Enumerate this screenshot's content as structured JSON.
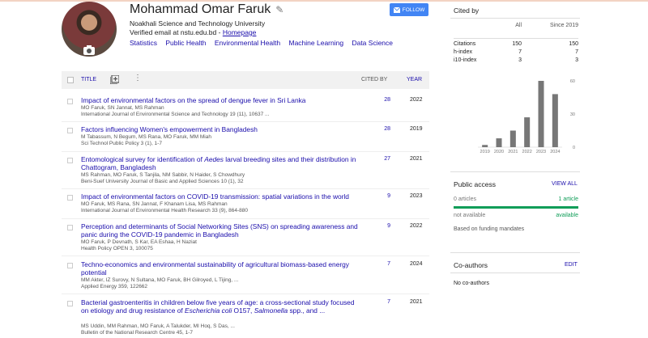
{
  "profile": {
    "name": "Mohammad Omar Faruk",
    "affiliation": "Noakhali Science and Technology University",
    "email_text": "Verified email at nstu.edu.bd - ",
    "homepage_label": "Homepage",
    "interests": [
      "Statistics",
      "Public Health",
      "Environmental Health",
      "Machine Learning",
      "Data Science"
    ],
    "follow_label": "FOLLOW"
  },
  "table": {
    "title_header": "TITLE",
    "cited_by_header": "CITED BY",
    "year_header": "YEAR",
    "rows": [
      {
        "title": "Impact of environmental factors on the spread of dengue fever in Sri Lanka",
        "authors": "MO Faruk, SN Jannat, MS Rahman",
        "venue": "International Journal of Environmental Science and Technology 19 (11), 10637 ...",
        "cited_by": "28",
        "year": "2022"
      },
      {
        "title": "Factors influencing Women's empowerment in Bangladesh",
        "authors": "M Tabassum, N Begum, MS Rana, MO Faruk, MM Miah",
        "venue": "Sci Technol Public Policy 3 (1), 1-7",
        "cited_by": "28",
        "year": "2019"
      },
      {
        "title": "Entomological survey for identification of Aedes larval breeding sites and their distribution in Chattogram, Bangladesh",
        "authors": "MS Rahman, MO Faruk, S Tanjila, NM Sabbir, N Haider, S Chowdhury",
        "venue": "Beni-Suef University Journal of Basic and Applied Sciences 10 (1), 32",
        "cited_by": "27",
        "year": "2021"
      },
      {
        "title": "Impact of environmental factors on COVID-19 transmission: spatial variations in the world",
        "authors": "MO Faruk, MS Rana, SN Jannat, F Khanam Lisa, MS Rahman",
        "venue": "International Journal of Environmental Health Research 33 (9), 864-880",
        "cited_by": "9",
        "year": "2023"
      },
      {
        "title": "Perception and determinants of Social Networking Sites (SNS) on spreading awareness and panic during the COVID-19 pandemic in Bangladesh",
        "authors": "MO Faruk, P Devnath, S Kar, EA Eshaa, H Naziat",
        "venue": "Health Policy OPEN 3, 100075",
        "cited_by": "9",
        "year": "2022"
      },
      {
        "title": "Techno-economics and environmental sustainability of agricultural biomass-based energy potential",
        "authors": "MM Akter, IZ Surovy, N Sultana, MO Faruk, BH Gilroyed, L Tijing, ...",
        "venue": "Applied Energy 359, 122662",
        "cited_by": "7",
        "year": "2024"
      },
      {
        "title": "Bacterial gastroenteritis in children below five years of age: a cross-sectional study focused on etiology and drug resistance of Escherichia coli O157, Salmonella spp., and ...",
        "authors": "MS Uddin, MM Rahman, MO Faruk, A Talukder, MI Hoq, S Das, ...",
        "venue": "Bulletin of the National Research Centre 45, 1-7",
        "cited_by": "7",
        "year": "2021"
      }
    ]
  },
  "cited_by_panel": {
    "heading": "Cited by",
    "col_all": "All",
    "col_since": "Since 2019",
    "metrics": [
      {
        "label": "Citations",
        "all": "150",
        "since": "150"
      },
      {
        "label": "h-index",
        "all": "7",
        "since": "7"
      },
      {
        "label": "i10-index",
        "all": "3",
        "since": "3"
      }
    ]
  },
  "chart_data": {
    "type": "bar",
    "categories": [
      "2019",
      "2020",
      "2021",
      "2022",
      "2023",
      "2024"
    ],
    "values": [
      2,
      8,
      15,
      27,
      60,
      48
    ],
    "yticks": [
      "60",
      "30",
      "0"
    ],
    "ylim": [
      0,
      60
    ],
    "bar_color": "#777777"
  },
  "public_access": {
    "heading": "Public access",
    "view_all": "VIEW ALL",
    "not_available_count": "0 articles",
    "available_count": "1 article",
    "not_available_label": "not available",
    "available_label": "available",
    "note": "Based on funding mandates"
  },
  "coauthors": {
    "heading": "Co-authors",
    "edit": "EDIT",
    "empty": "No co-authors"
  }
}
